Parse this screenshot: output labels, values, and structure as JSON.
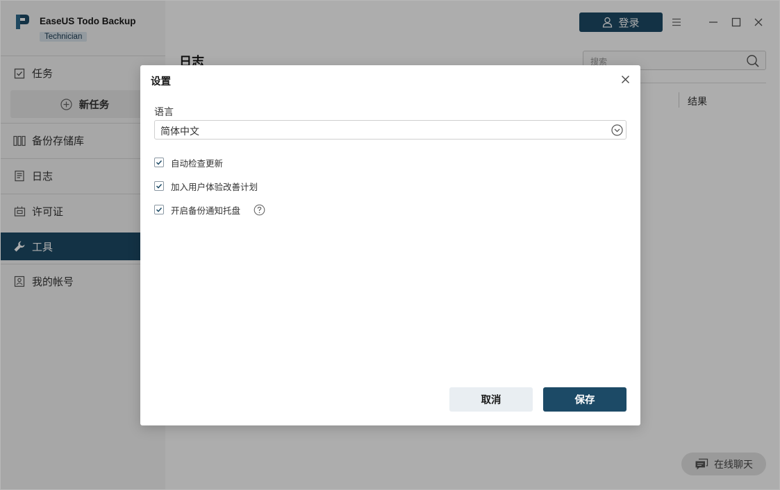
{
  "app": {
    "title": "EaseUS Todo Backup",
    "edition": "Technician"
  },
  "sidebar": {
    "items": [
      {
        "label": "任务",
        "icon": "task-check-icon"
      },
      {
        "label": "备份存储库",
        "icon": "storage-library-icon"
      },
      {
        "label": "日志",
        "icon": "log-icon"
      },
      {
        "label": "许可证",
        "icon": "license-icon"
      },
      {
        "label": "工具",
        "icon": "wrench-icon",
        "active": true
      },
      {
        "label": "我的帐号",
        "icon": "account-icon"
      }
    ],
    "new_task_label": "新任务"
  },
  "header": {
    "login_label": "登录"
  },
  "main": {
    "page_title": "日志",
    "search_placeholder": "搜索",
    "result_column": "结果",
    "chat_label": "在线聊天"
  },
  "dialog": {
    "title": "设置",
    "language_label": "语言",
    "language_value": "简体中文",
    "options": [
      {
        "label": "自动检查更新",
        "checked": true
      },
      {
        "label": "加入用户体验改善计划",
        "checked": true
      },
      {
        "label": "开启备份通知托盘",
        "checked": true,
        "help": true
      }
    ],
    "cancel_label": "取消",
    "save_label": "保存"
  },
  "colors": {
    "accent": "#1c4a66",
    "sidebar_bg": "#f7f7f7",
    "cancel_bg": "#e9eef2"
  }
}
